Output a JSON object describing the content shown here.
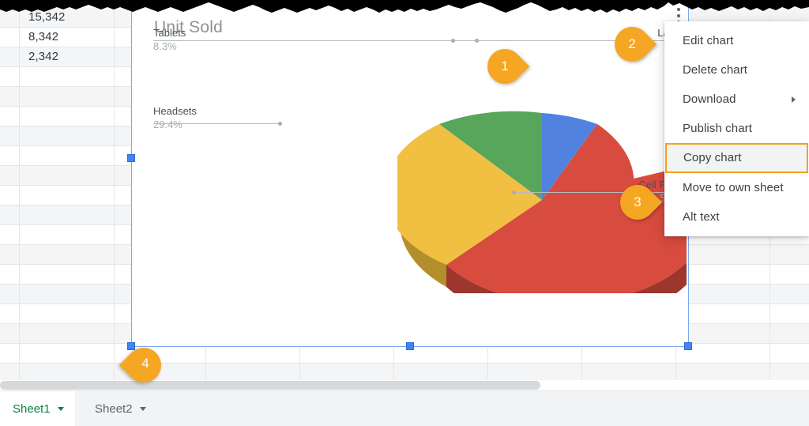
{
  "spreadsheet": {
    "cells": [
      {
        "value": "15,342"
      },
      {
        "value": "8,342"
      },
      {
        "value": "2,342"
      }
    ]
  },
  "chart": {
    "title": "Unit Sold",
    "kebab_icon": "more-vert-icon",
    "colors": {
      "blue": "#5282e0",
      "red": "#d84b3f",
      "yellow": "#f1c043",
      "green": "#58a55c",
      "blue_dark": "#3a63b8",
      "red_dark": "#9d362d",
      "yellow_dark": "#b38f2c",
      "green_dark": "#3f7a42",
      "selection": "#4285f4",
      "title_text": "#8d9296"
    },
    "chart_data": {
      "type": "pie",
      "title": "Unit Sold",
      "is3d": true,
      "legend_position": "labeled",
      "categories": [
        "Laptop",
        "Cell Phone",
        "Headsets",
        "Tablets"
      ],
      "values": [
        8.3,
        54.1,
        29.4,
        8.3
      ],
      "labels": [
        {
          "name": "Tablets",
          "percent": "8.3%",
          "value": 8.3,
          "color": "#58a55c"
        },
        {
          "name": "Laptop",
          "percent": "8.3%",
          "value": 8.3,
          "color": "#5282e0"
        },
        {
          "name": "Headsets",
          "percent": "29.4%",
          "value": 29.4,
          "color": "#f1c043"
        },
        {
          "name": "Cell Phone",
          "percent": "54.1%",
          "value": 54.1,
          "color": "#d84b3f"
        }
      ],
      "xlabel": "",
      "ylabel": ""
    }
  },
  "context_menu": {
    "items": [
      {
        "label": "Edit chart",
        "selected": false,
        "submenu": false
      },
      {
        "label": "Delete chart",
        "selected": false,
        "submenu": false
      },
      {
        "label": "Download",
        "selected": false,
        "submenu": true
      },
      {
        "label": "Publish chart",
        "selected": false,
        "submenu": false
      },
      {
        "label": "Copy chart",
        "selected": true,
        "submenu": false
      },
      {
        "label": "Move to own sheet",
        "selected": false,
        "submenu": false
      },
      {
        "label": "Alt text",
        "selected": false,
        "submenu": false
      }
    ],
    "highlight_color": "#f2a21b"
  },
  "callouts": [
    {
      "number": "1"
    },
    {
      "number": "2"
    },
    {
      "number": "3"
    },
    {
      "number": "4"
    }
  ],
  "sheet_tabs": [
    {
      "name": "Sheet1",
      "active": true,
      "caret": "chevron-down-icon"
    },
    {
      "name": "Sheet2",
      "active": false,
      "caret": "chevron-down-icon"
    }
  ]
}
